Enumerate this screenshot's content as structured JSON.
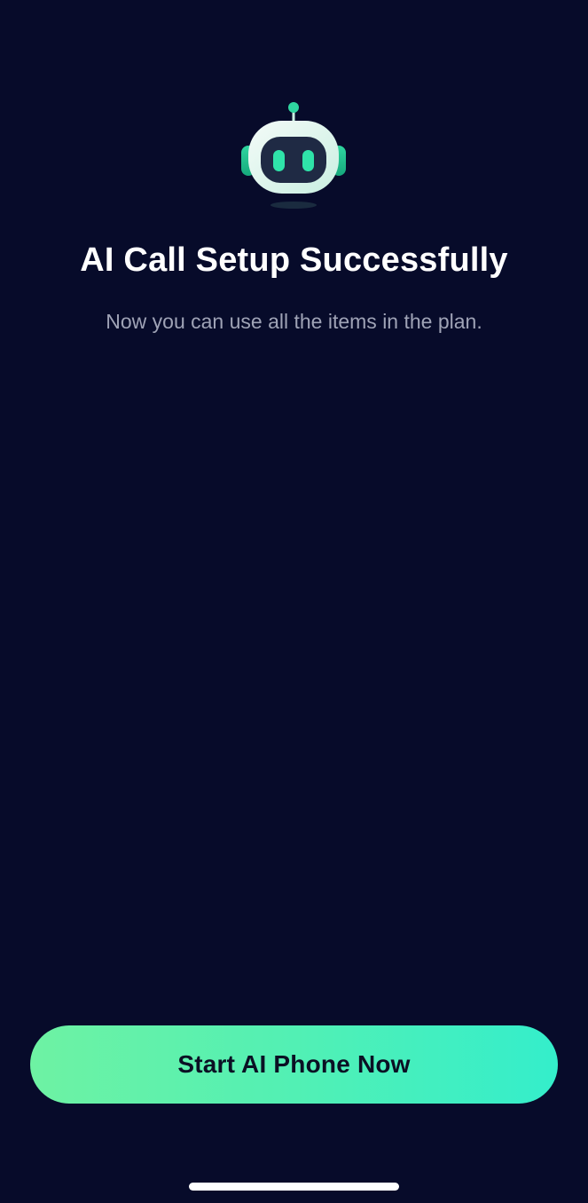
{
  "icon": "robot-icon",
  "title": "AI Call Setup Successfully",
  "subtitle": "Now you can use all the items in the plan.",
  "button": {
    "label": "Start AI Phone Now"
  },
  "colors": {
    "background": "#070b2a",
    "accent_start": "#6ef2a3",
    "accent_end": "#34eecb",
    "title": "#ffffff",
    "subtitle": "#9fa3b6"
  }
}
